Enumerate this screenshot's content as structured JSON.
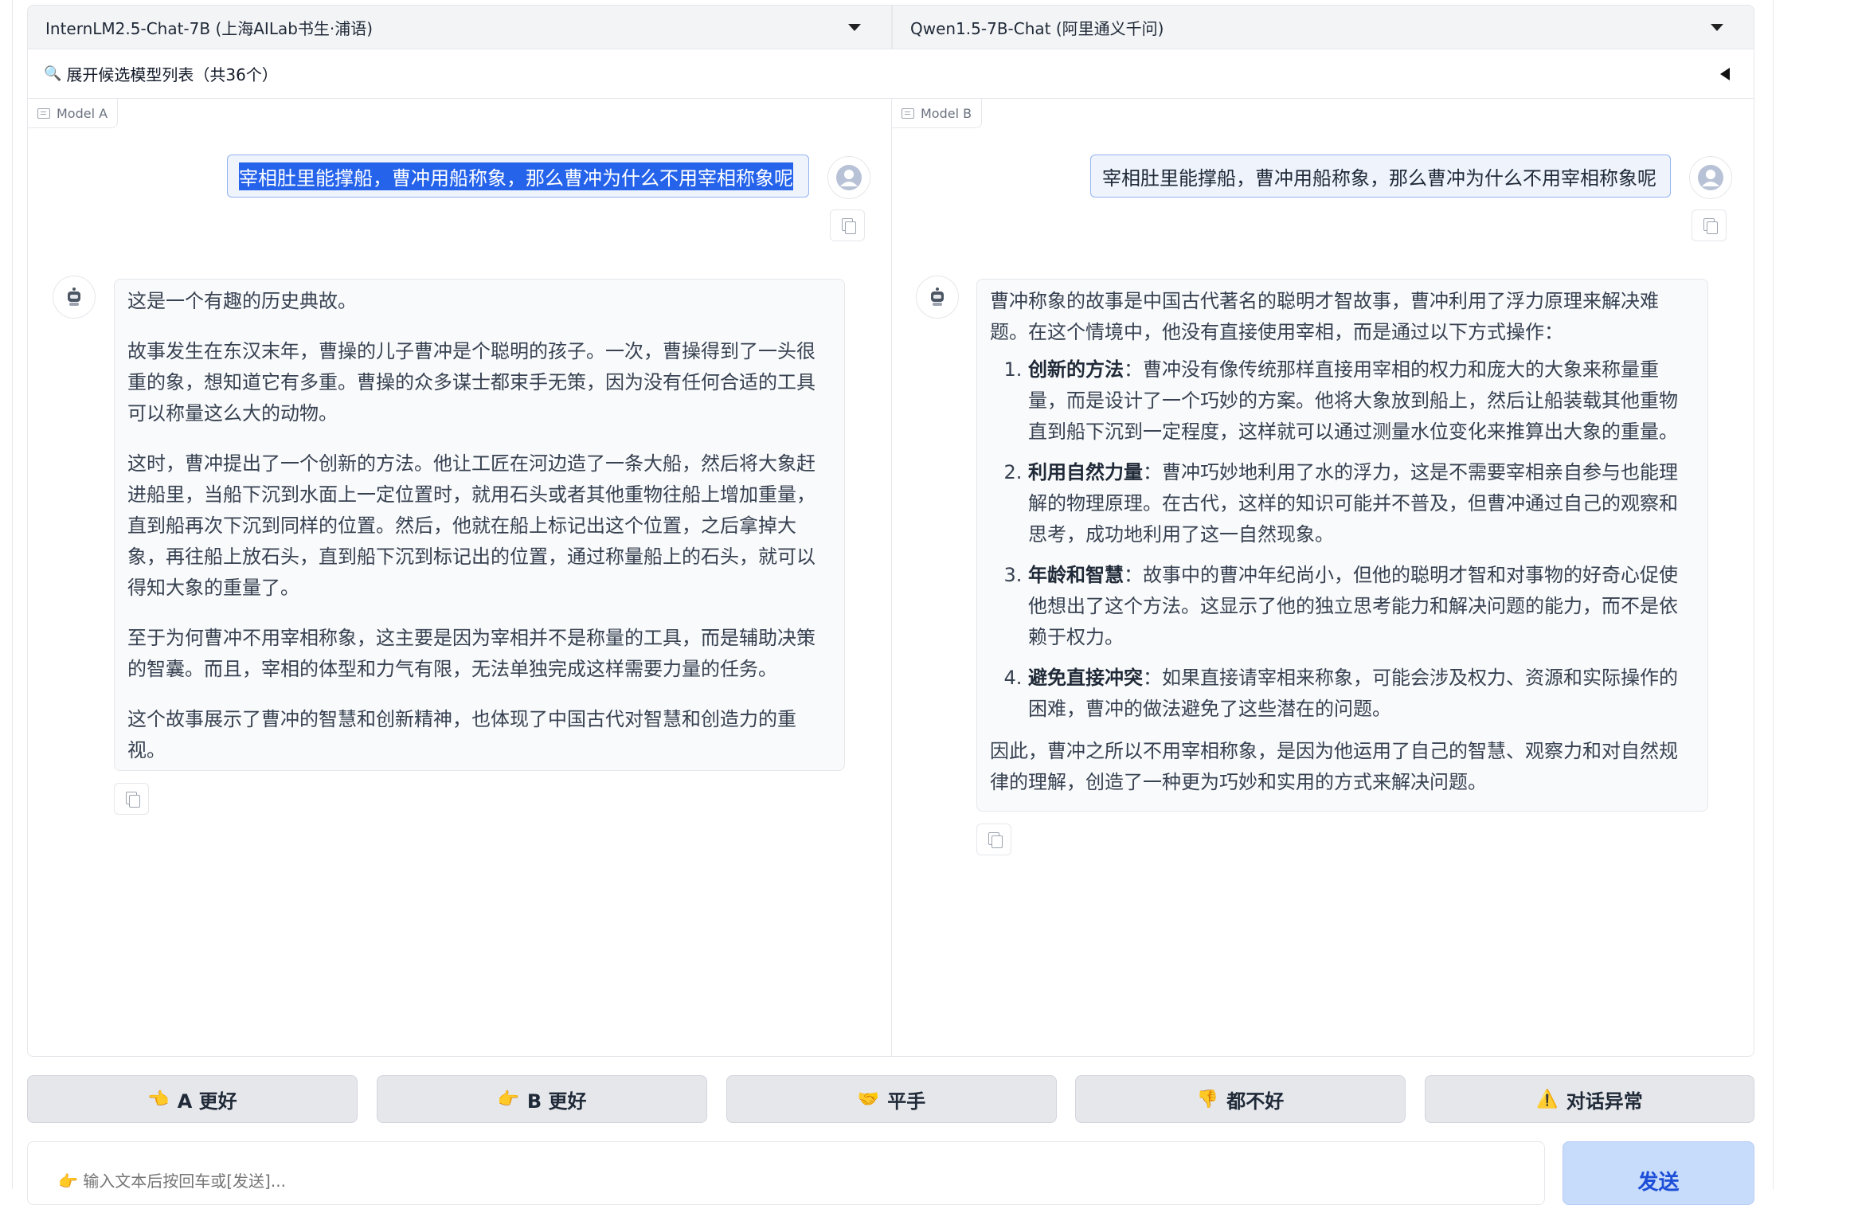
{
  "model_selectors": {
    "a": "InternLM2.5-Chat-7B (上海AILab书生·浦语)",
    "b": "Qwen1.5-7B-Chat (阿里通义千问)"
  },
  "expand_bar": {
    "icon": "🔍",
    "label": "展开候选模型列表（共36个）"
  },
  "panel_a": {
    "tag": "Model A",
    "user_message": "宰相肚里能撑船，曹冲用船称象，那么曹冲为什么不用宰相称象呢",
    "bot_paragraphs": [
      "这是一个有趣的历史典故。",
      "故事发生在东汉末年，曹操的儿子曹冲是个聪明的孩子。一次，曹操得到了一头很重的象，想知道它有多重。曹操的众多谋士都束手无策，因为没有任何合适的工具可以称量这么大的动物。",
      "这时，曹冲提出了一个创新的方法。他让工匠在河边造了一条大船，然后将大象赶进船里，当船下沉到水面上一定位置时，就用石头或者其他重物往船上增加重量，直到船再次下沉到同样的位置。然后，他就在船上标记出这个位置，之后拿掉大象，再往船上放石头，直到船下沉到标记出的位置，通过称量船上的石头，就可以得知大象的重量了。",
      "至于为何曹冲不用宰相称象，这主要是因为宰相并不是称量的工具，而是辅助决策的智囊。而且，宰相的体型和力气有限，无法单独完成这样需要力量的任务。",
      "这个故事展示了曹冲的智慧和创新精神，也体现了中国古代对智慧和创造力的重视。"
    ]
  },
  "panel_b": {
    "tag": "Model B",
    "user_message": "宰相肚里能撑船，曹冲用船称象，那么曹冲为什么不用宰相称象呢",
    "intro": "曹冲称象的故事是中国古代著名的聪明才智故事，曹冲利用了浮力原理来解决难题。在这个情境中，他没有直接使用宰相，而是通过以下方式操作：",
    "items": [
      {
        "title": "创新的方法",
        "text": "：曹冲没有像传统那样直接用宰相的权力和庞大的大象来称量重量，而是设计了一个巧妙的方案。他将大象放到船上，然后让船装载其他重物直到船下沉到一定程度，这样就可以通过测量水位变化来推算出大象的重量。"
      },
      {
        "title": "利用自然力量",
        "text": "：曹冲巧妙地利用了水的浮力，这是不需要宰相亲自参与也能理解的物理原理。在古代，这样的知识可能并不普及，但曹冲通过自己的观察和思考，成功地利用了这一自然现象。"
      },
      {
        "title": "年龄和智慧",
        "text": "：故事中的曹冲年纪尚小，但他的聪明才智和对事物的好奇心促使他想出了这个方法。这显示了他的独立思考能力和解决问题的能力，而不是依赖于权力。"
      },
      {
        "title": "避免直接冲突",
        "text": "：如果直接请宰相来称象，可能会涉及权力、资源和实际操作的困难，曹冲的做法避免了这些潜在的问题。"
      }
    ],
    "conclusion": "因此，曹冲之所以不用宰相称象，是因为他运用了自己的智慧、观察力和对自然规律的理解，创造了一种更为巧妙和实用的方式来解决问题。"
  },
  "vote_buttons": [
    {
      "emoji": "👈",
      "label": "A 更好"
    },
    {
      "emoji": "👉",
      "label": "B 更好"
    },
    {
      "emoji": "🤝",
      "label": "平手"
    },
    {
      "emoji": "👎",
      "label": "都不好"
    },
    {
      "emoji": "⚠️",
      "label": "对话异常"
    }
  ],
  "input": {
    "placeholder": "👉 输入文本后按回车或[发送]..."
  },
  "send_label": "发送"
}
